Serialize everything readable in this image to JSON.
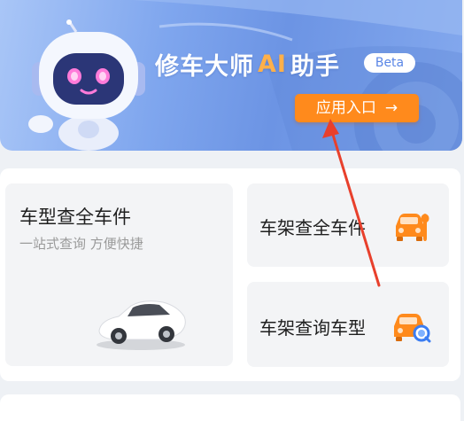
{
  "banner": {
    "title_prefix": "修车大师",
    "title_ai": "AI",
    "title_suffix": "助手",
    "badge": "Beta",
    "entry_button": "应用入口",
    "entry_arrow": "→"
  },
  "cards": {
    "left": {
      "title": "车型查全车件",
      "subtitle": "一站式查询 方便快捷",
      "illustration": "white-car"
    },
    "right": [
      {
        "label": "车架查全车件",
        "icon": "car-wrench-icon"
      },
      {
        "label": "车架查询车型",
        "icon": "car-search-icon"
      }
    ]
  },
  "colors": {
    "accent_orange": "#ff8a1c",
    "banner_blue": "#7fa6ee",
    "annotation_red": "#e8402c"
  }
}
